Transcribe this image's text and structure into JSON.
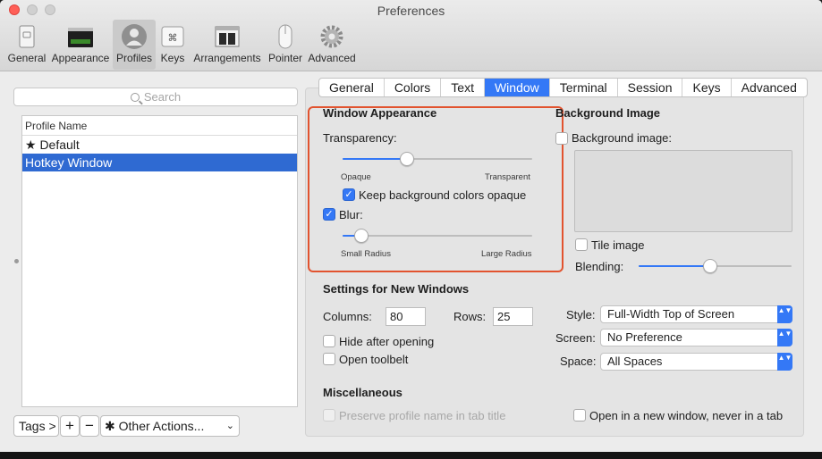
{
  "window": {
    "title": "Preferences"
  },
  "toolbar": [
    {
      "label": "General",
      "icon": "general-icon"
    },
    {
      "label": "Appearance",
      "icon": "appearance-icon"
    },
    {
      "label": "Profiles",
      "icon": "profiles-icon",
      "selected": true
    },
    {
      "label": "Keys",
      "icon": "keys-icon"
    },
    {
      "label": "Arrangements",
      "icon": "arrangements-icon"
    },
    {
      "label": "Pointer",
      "icon": "pointer-icon"
    },
    {
      "label": "Advanced",
      "icon": "advanced-icon"
    }
  ],
  "sidebar": {
    "search_placeholder": "Search",
    "column_header": "Profile Name",
    "profiles": [
      {
        "name": "★ Default",
        "selected": false
      },
      {
        "name": "Hotkey Window",
        "selected": true
      }
    ],
    "tags_label": "Tags >",
    "add_label": "+",
    "remove_label": "−",
    "other_actions_label": "Other Actions...",
    "other_actions_caret": "⌄",
    "gear_glyph": "✱"
  },
  "tabs": [
    {
      "label": "General"
    },
    {
      "label": "Colors"
    },
    {
      "label": "Text"
    },
    {
      "label": "Window",
      "active": true
    },
    {
      "label": "Terminal"
    },
    {
      "label": "Session"
    },
    {
      "label": "Keys"
    },
    {
      "label": "Advanced"
    }
  ],
  "window_appearance": {
    "heading": "Window Appearance",
    "transparency_label": "Transparency:",
    "transparency_value": 0.34,
    "opaque_label": "Opaque",
    "transparent_label": "Transparent",
    "keep_bg_opaque_label": "Keep background colors opaque",
    "keep_bg_opaque_checked": true,
    "blur_label": "Blur:",
    "blur_checked": true,
    "blur_value": 0.1,
    "small_radius_label": "Small Radius",
    "large_radius_label": "Large Radius",
    "highlight_color": "#e2532f"
  },
  "background_image": {
    "heading": "Background Image",
    "bg_image_label": "Background image:",
    "bg_image_checked": false,
    "tile_label": "Tile image",
    "tile_checked": false,
    "blending_label": "Blending:",
    "blending_value": 0.47
  },
  "new_windows": {
    "heading": "Settings for New Windows",
    "columns_label": "Columns:",
    "columns_value": "80",
    "rows_label": "Rows:",
    "rows_value": "25",
    "hide_label": "Hide after opening",
    "hide_checked": false,
    "toolbelt_label": "Open toolbelt",
    "toolbelt_checked": false,
    "style_label": "Style:",
    "style_value": "Full-Width Top of Screen",
    "screen_label": "Screen:",
    "screen_value": "No Preference",
    "space_label": "Space:",
    "space_value": "All Spaces",
    "stepper_glyph": "▲▼"
  },
  "misc": {
    "heading": "Miscellaneous",
    "preserve_label": "Preserve profile name in tab title",
    "new_window_label": "Open in a new window, never in a tab"
  },
  "colors": {
    "accent": "#3478f6",
    "selection": "#2f6ad2"
  }
}
